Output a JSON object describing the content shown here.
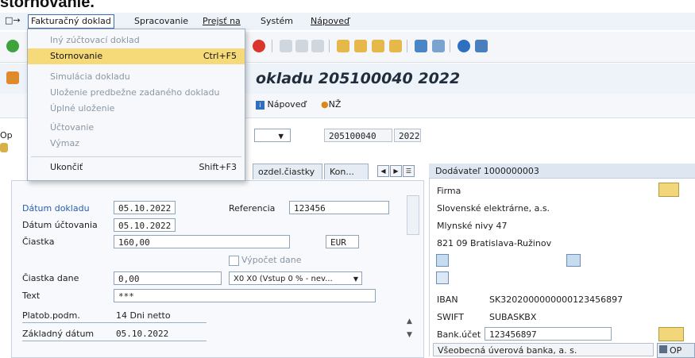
{
  "page_heading": "stornovanie.",
  "menubar": {
    "items": [
      {
        "label": "Fakturačný doklad"
      },
      {
        "label": "Spracovanie"
      },
      {
        "label": "Prejsť na"
      },
      {
        "label": "Systém"
      },
      {
        "label": "Nápoveď"
      }
    ]
  },
  "menu": {
    "items": [
      {
        "label": "Iný zúčtovací doklad",
        "shortcut": "",
        "disabled": true
      },
      {
        "label": "Stornovanie",
        "shortcut": "Ctrl+F5",
        "selected": true
      },
      {
        "label": "Simulácia dokladu",
        "shortcut": "",
        "disabled": true
      },
      {
        "label": "Uloženie predbežne zadaného dokladu",
        "shortcut": "",
        "disabled": true
      },
      {
        "label": "Úplné uloženie",
        "shortcut": "",
        "disabled": true
      },
      {
        "label": "Účtovanie",
        "shortcut": "",
        "disabled": true
      },
      {
        "label": "Výmaz",
        "shortcut": "",
        "disabled": true
      },
      {
        "label": "Ukončiť",
        "shortcut": "Shift+F3",
        "disabled": false
      }
    ]
  },
  "title": "okladu 205100040 2022",
  "apptoolbar": {
    "help": "Nápoveď",
    "nz": "NŽ"
  },
  "header": {
    "op_label": "Op",
    "doc_number": "205100040",
    "year": "2022"
  },
  "tabs": [
    {
      "label": "ozdel.čiastky"
    },
    {
      "label": "Kon..."
    }
  ],
  "basic": {
    "datum_dokladu_label": "Dátum dokladu",
    "datum_dokladu": "05.10.2022",
    "referencia_label": "Referencia",
    "referencia": "123456",
    "datum_uctovania_label": "Dátum účtovania",
    "datum_uctovania": "05.10.2022",
    "ciastka_label": "Čiastka",
    "ciastka": "160,00",
    "currency": "EUR",
    "vypocet_dane_label": "Výpočet dane",
    "ciastka_dane_label": "Čiastka dane",
    "ciastka_dane": "0,00",
    "tax_code": "X0 X0 (Vstup 0 % - nev...",
    "text_label": "Text",
    "text_value": "***",
    "platob_label": "Platob.podm.",
    "platob_value": "14 Dni netto",
    "zakladny_label": "Základný dátum",
    "zakladny_value": "05.10.2022"
  },
  "vendor": {
    "header": "Dodávateľ 1000000003",
    "firma": "Firma",
    "name": "Slovenské elektrárne, a.s.",
    "street": "Mlynské nivy 47",
    "city": "821 09 Bratislava-Ružinov",
    "iban_label": "IBAN",
    "iban": "SK3202000000000123456897",
    "swift_label": "SWIFT",
    "swift": "SUBASKBX",
    "bank_label": "Bank.účet",
    "bank_account": "123456897",
    "bank_name": "Všeobecná úverová banka, a. s.",
    "op_button": "OP"
  }
}
